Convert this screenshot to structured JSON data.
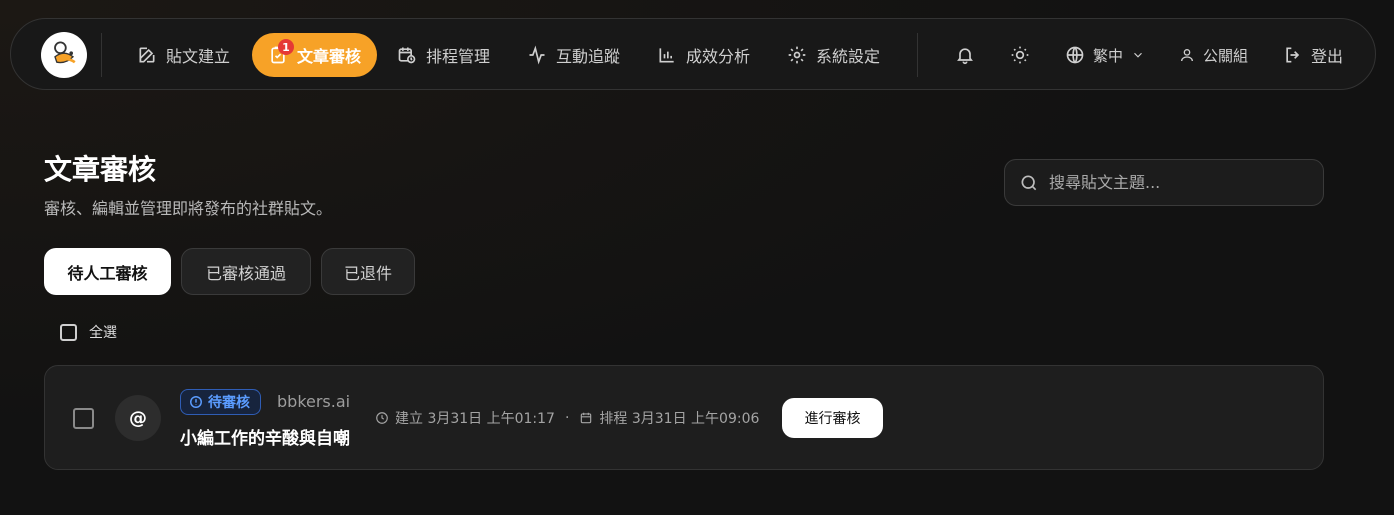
{
  "nav": {
    "items": [
      {
        "label": "貼文建立",
        "icon": "pencil-square-icon"
      },
      {
        "label": "文章審核",
        "icon": "clipboard-check-icon",
        "badge": "1"
      },
      {
        "label": "排程管理",
        "icon": "calendar-clock-icon"
      },
      {
        "label": "互動追蹤",
        "icon": "activity-icon"
      },
      {
        "label": "成效分析",
        "icon": "bar-chart-icon"
      },
      {
        "label": "系統設定",
        "icon": "gear-icon"
      }
    ],
    "language": "繁中",
    "user": "公關組",
    "logout": "登出"
  },
  "header": {
    "title": "文章審核",
    "subtitle": "審核、編輯並管理即將發布的社群貼文。",
    "search_placeholder": "搜尋貼文主題..."
  },
  "tabs": [
    {
      "label": "待人工審核",
      "active": true
    },
    {
      "label": "已審核通過",
      "active": false
    },
    {
      "label": "已退件",
      "active": false
    }
  ],
  "select_all_label": "全選",
  "posts": [
    {
      "avatar": "@",
      "status": "待審核",
      "source": "bbkers.ai",
      "title": "小編工作的辛酸與自嘲",
      "created": "建立 3月31日 上午01:17",
      "separator": "·",
      "scheduled": "排程 3月31日 上午09:06",
      "action": "進行審核"
    }
  ],
  "colors": {
    "accent": "#f7a227",
    "status_blue": "#5b9cff",
    "badge_red": "#e53935"
  }
}
